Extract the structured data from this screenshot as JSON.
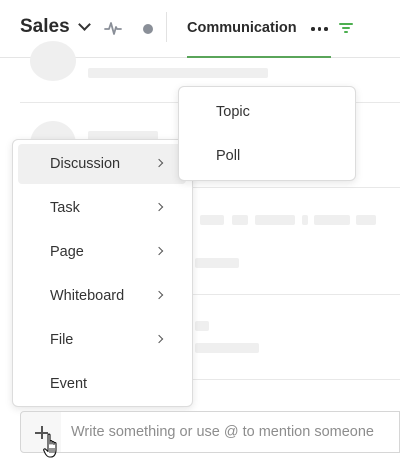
{
  "header": {
    "team_name": "Sales",
    "tab_label": "Communication",
    "icons": [
      "chevron-down-icon",
      "activity-icon",
      "status-dot-icon",
      "more-icon",
      "filter-icon"
    ]
  },
  "create_menu": {
    "items": [
      {
        "label": "Discussion",
        "has_submenu": true,
        "active": true
      },
      {
        "label": "Task",
        "has_submenu": true
      },
      {
        "label": "Page",
        "has_submenu": true
      },
      {
        "label": "Whiteboard",
        "has_submenu": true
      },
      {
        "label": "File",
        "has_submenu": true
      },
      {
        "label": "Event",
        "has_submenu": false
      }
    ]
  },
  "discussion_submenu": {
    "items": [
      {
        "label": "Topic"
      },
      {
        "label": "Poll"
      }
    ]
  },
  "composer": {
    "placeholder": "Write something or use @ to mention someone",
    "value": ""
  },
  "colors": {
    "accent": "#5aa55a",
    "skeleton": "#efefef",
    "status_dot": "#8a8f98"
  }
}
